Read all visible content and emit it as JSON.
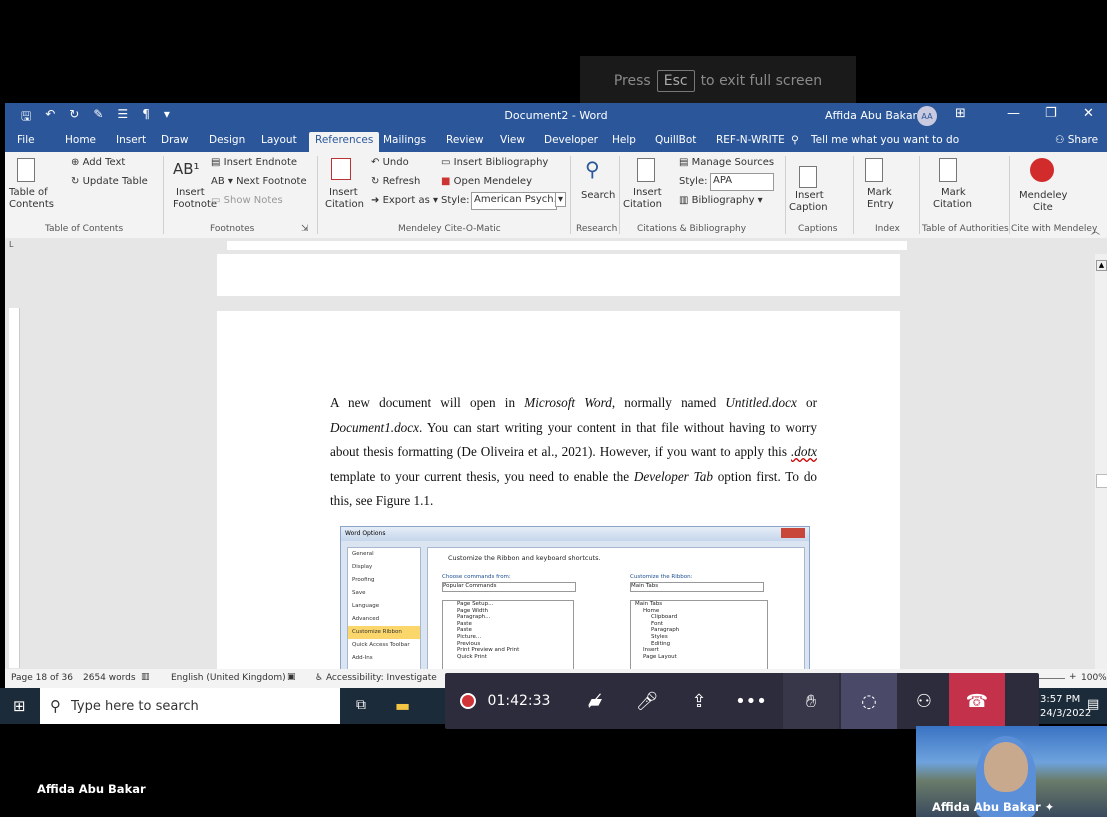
{
  "fullscreen_banner": {
    "pre": "Press",
    "key": "Esc",
    "post": "to exit full screen"
  },
  "word": {
    "title": "Document2 - Word",
    "user": "Affida Abu Bakar",
    "user_initials": "AA",
    "tabs": [
      "File",
      "Home",
      "Insert",
      "Draw",
      "Design",
      "Layout",
      "References",
      "Mailings",
      "Review",
      "View",
      "Developer",
      "Help",
      "QuillBot",
      "REF-N-WRITE"
    ],
    "active_tab": "References",
    "tell_me": "Tell me what you want to do",
    "share": "Share",
    "ribbon": {
      "toc": {
        "add_text": "Add Text",
        "update_table": "Update Table",
        "table_of": "Table of",
        "contents": "Contents",
        "group": "Table of Contents"
      },
      "footnotes": {
        "insert_endnote": "Insert Endnote",
        "next_footnote": "Next Footnote",
        "show_notes": "Show Notes",
        "insert": "Insert",
        "footnote": "Footnote",
        "group": "Footnotes"
      },
      "mendeley": {
        "undo": "Undo",
        "refresh": "Refresh",
        "export_as": "Export as",
        "insert": "Insert",
        "citation": "Citation",
        "insert_bibliography": "Insert Bibliography",
        "open_mendeley": "Open Mendeley",
        "style_label": "Style:",
        "style_value": "American Psych...",
        "group": "Mendeley Cite-O-Matic"
      },
      "research": {
        "search": "Search",
        "group": "Research"
      },
      "citations": {
        "insert": "Insert",
        "citation": "Citation",
        "manage_sources": "Manage Sources",
        "style_label": "Style:",
        "style_value": "APA",
        "bibliography": "Bibliography",
        "group": "Citations & Bibliography"
      },
      "captions": {
        "insert": "Insert",
        "caption": "Caption",
        "group": "Captions"
      },
      "index": {
        "mark": "Mark",
        "entry": "Entry",
        "group": "Index"
      },
      "toa": {
        "mark": "Mark",
        "citation": "Citation",
        "group": "Table of Authorities"
      },
      "mendeley_cite": {
        "mendeley": "Mendeley",
        "cite": "Cite",
        "group": "Cite with Mendeley"
      }
    },
    "document": {
      "p1": "A new document will open in ",
      "p1_i1": "Microsoft Word",
      "p1_b": ", normally named ",
      "p1_i2": "Untitled.docx",
      "p1_c": " or ",
      "p1_i3": "Document1.docx",
      "p1_d": ". You can start writing your content in that file without having to worry about thesis formatting (De Oliveira et al., 2021). However, if you want to apply this ",
      "p1_i4": ".dotx",
      "p1_e": " template to your current thesis, you need to enable the ",
      "p1_i5": "Developer Tab",
      "p1_f": " option first. To do this, see Figure 1.1."
    },
    "dialog": {
      "title": "Word Options",
      "left_items": [
        "General",
        "Display",
        "Proofing",
        "Save",
        "Language",
        "Advanced",
        "Customize Ribbon",
        "Quick Access Toolbar",
        "Add-Ins"
      ],
      "selected": "Customize Ribbon",
      "heading": "Customize the Ribbon and keyboard shortcuts.",
      "choose_label": "Choose commands from:",
      "choose_value": "Popular Commands",
      "customize_label": "Customize the Ribbon:",
      "customize_value": "Main Tabs",
      "commands": [
        "Page Setup...",
        "Page Width",
        "Paragraph...",
        "Paste",
        "Paste",
        "Picture...",
        "Previous",
        "Print Preview and Print",
        "Quick Print"
      ],
      "tabs_tree": [
        "Main Tabs",
        "Home",
        "Clipboard",
        "Font",
        "Paragraph",
        "Styles",
        "Editing",
        "Insert",
        "Page Layout"
      ]
    },
    "status": {
      "page": "Page 18 of 36",
      "words": "2654 words",
      "language": "English (United Kingdom)",
      "accessibility": "Accessibility: Investigate",
      "zoom": "100%"
    }
  },
  "taskbar": {
    "search_placeholder": "Type here to search",
    "time": "3:57 PM",
    "date": "24/3/2022"
  },
  "teams": {
    "timer": "01:42:33"
  },
  "participants": {
    "left_name": "Affida Abu Bakar",
    "pip_name": "Affida Abu Bakar"
  }
}
